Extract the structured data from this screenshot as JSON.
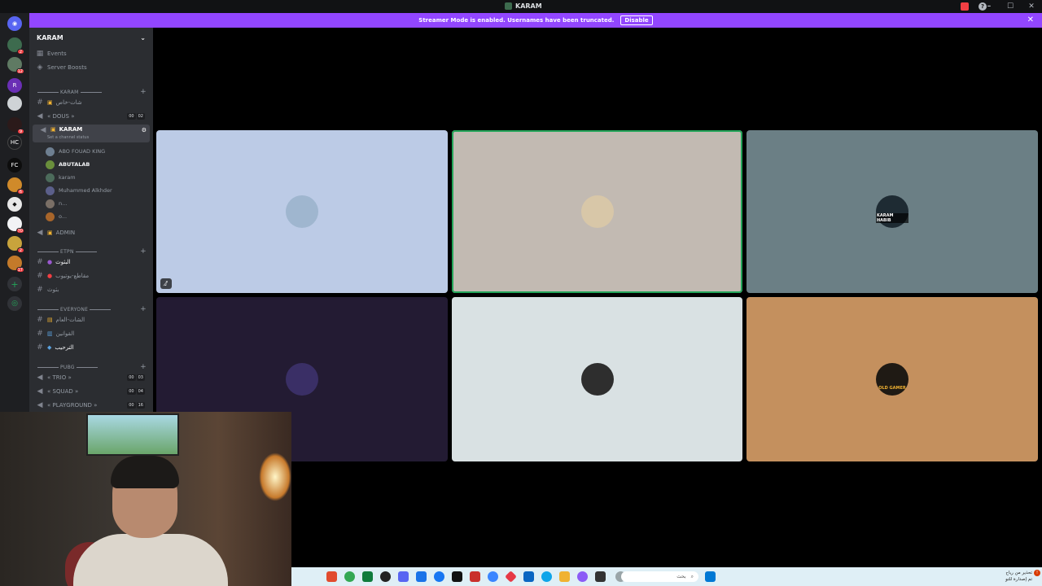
{
  "window": {
    "title": "KARAM"
  },
  "banner": {
    "text": "Streamer Mode is enabled. Usernames have been truncated.",
    "disable_label": "Disable"
  },
  "guild": {
    "name": "KARAM"
  },
  "nav": {
    "events": "Events",
    "boosts": "Server Boosts"
  },
  "categories": {
    "karam": "KARAM",
    "etpn": "ETPN",
    "everyone": "EVERYONE",
    "pubg": "PUBG"
  },
  "channels": {
    "chat_private": "شات-خاص",
    "dous": "« DOUS »",
    "dous_counts": [
      "00",
      "02"
    ],
    "karam_voice": "KARAM",
    "karam_status": "Set a channel status",
    "admin": "ADMIN",
    "live": "البثوث",
    "youtube": "مقاطع-يوتيوب",
    "streams": "بثوث",
    "general_chat": "الشات-العام",
    "rules": "القوانين",
    "welcome": "الترحيب",
    "trio": "« TRIO »",
    "trio_counts": [
      "00",
      "03"
    ],
    "squad": "« SQUAD »",
    "squad_counts": [
      "00",
      "04"
    ],
    "playground": "« PLAYGROUND »",
    "playground_counts": [
      "00",
      "16"
    ]
  },
  "voice_members": [
    {
      "name": "ABO FOUAD KING",
      "bold": false
    },
    {
      "name": "ABUTALAB",
      "bold": true
    },
    {
      "name": "karam",
      "bold": false
    },
    {
      "name": "Muhammed Alkhder",
      "bold": false
    },
    {
      "name": "n...",
      "bold": false
    },
    {
      "name": "o...",
      "bold": false
    }
  ],
  "tiles": [
    {
      "label": "",
      "bg": "#bccbe6",
      "avatar_bg": "#9fb6cf"
    },
    {
      "label": "",
      "bg": "#c2bab2",
      "avatar_bg": "#d8c7a8",
      "speaking": true
    },
    {
      "label": "KARAM HABIB",
      "bg": "#6b7f85",
      "avatar_bg": "#1e2b33"
    },
    {
      "label": "",
      "bg": "#231b33",
      "avatar_bg": "#3a2f66"
    },
    {
      "label": "",
      "bg": "#d9e1e3",
      "avatar_bg": "#2e2e2e"
    },
    {
      "label": "OLD GAMER",
      "bg": "#c4905e",
      "avatar_bg": "#1f1a14"
    }
  ],
  "servers": [
    {
      "badge": ""
    },
    {
      "badge": "2"
    },
    {
      "badge": "12"
    },
    {
      "badge": ""
    },
    {
      "badge": ""
    },
    {
      "badge": "9"
    },
    {
      "badge": ""
    },
    {
      "badge": ""
    },
    {
      "badge": "6"
    },
    {
      "badge": "70"
    },
    {
      "badge": "2"
    },
    {
      "badge": "17"
    }
  ],
  "taskbar": {
    "search_placeholder": "بحث",
    "tray_line1": "تحذير من رياح",
    "tray_line2": "تم إصدارة للتو"
  },
  "colors": {
    "accent": "#9246ff",
    "speaking": "#23a559"
  }
}
